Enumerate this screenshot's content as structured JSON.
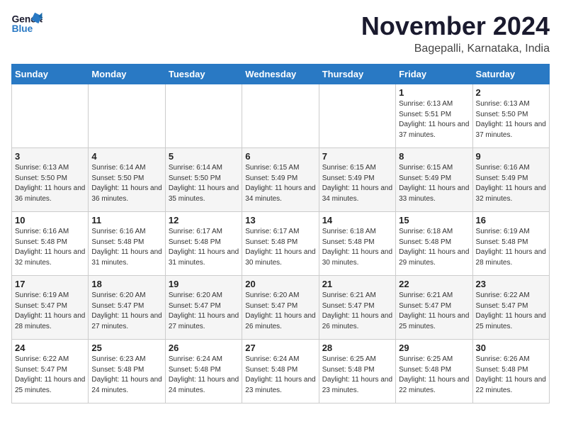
{
  "header": {
    "logo_general": "General",
    "logo_blue": "Blue",
    "month_title": "November 2024",
    "location": "Bagepalli, Karnataka, India"
  },
  "weekdays": [
    "Sunday",
    "Monday",
    "Tuesday",
    "Wednesday",
    "Thursday",
    "Friday",
    "Saturday"
  ],
  "weeks": [
    [
      {
        "day": "",
        "info": ""
      },
      {
        "day": "",
        "info": ""
      },
      {
        "day": "",
        "info": ""
      },
      {
        "day": "",
        "info": ""
      },
      {
        "day": "",
        "info": ""
      },
      {
        "day": "1",
        "info": "Sunrise: 6:13 AM\nSunset: 5:51 PM\nDaylight: 11 hours and 37 minutes."
      },
      {
        "day": "2",
        "info": "Sunrise: 6:13 AM\nSunset: 5:50 PM\nDaylight: 11 hours and 37 minutes."
      }
    ],
    [
      {
        "day": "3",
        "info": "Sunrise: 6:13 AM\nSunset: 5:50 PM\nDaylight: 11 hours and 36 minutes."
      },
      {
        "day": "4",
        "info": "Sunrise: 6:14 AM\nSunset: 5:50 PM\nDaylight: 11 hours and 36 minutes."
      },
      {
        "day": "5",
        "info": "Sunrise: 6:14 AM\nSunset: 5:50 PM\nDaylight: 11 hours and 35 minutes."
      },
      {
        "day": "6",
        "info": "Sunrise: 6:15 AM\nSunset: 5:49 PM\nDaylight: 11 hours and 34 minutes."
      },
      {
        "day": "7",
        "info": "Sunrise: 6:15 AM\nSunset: 5:49 PM\nDaylight: 11 hours and 34 minutes."
      },
      {
        "day": "8",
        "info": "Sunrise: 6:15 AM\nSunset: 5:49 PM\nDaylight: 11 hours and 33 minutes."
      },
      {
        "day": "9",
        "info": "Sunrise: 6:16 AM\nSunset: 5:49 PM\nDaylight: 11 hours and 32 minutes."
      }
    ],
    [
      {
        "day": "10",
        "info": "Sunrise: 6:16 AM\nSunset: 5:48 PM\nDaylight: 11 hours and 32 minutes."
      },
      {
        "day": "11",
        "info": "Sunrise: 6:16 AM\nSunset: 5:48 PM\nDaylight: 11 hours and 31 minutes."
      },
      {
        "day": "12",
        "info": "Sunrise: 6:17 AM\nSunset: 5:48 PM\nDaylight: 11 hours and 31 minutes."
      },
      {
        "day": "13",
        "info": "Sunrise: 6:17 AM\nSunset: 5:48 PM\nDaylight: 11 hours and 30 minutes."
      },
      {
        "day": "14",
        "info": "Sunrise: 6:18 AM\nSunset: 5:48 PM\nDaylight: 11 hours and 30 minutes."
      },
      {
        "day": "15",
        "info": "Sunrise: 6:18 AM\nSunset: 5:48 PM\nDaylight: 11 hours and 29 minutes."
      },
      {
        "day": "16",
        "info": "Sunrise: 6:19 AM\nSunset: 5:48 PM\nDaylight: 11 hours and 28 minutes."
      }
    ],
    [
      {
        "day": "17",
        "info": "Sunrise: 6:19 AM\nSunset: 5:47 PM\nDaylight: 11 hours and 28 minutes."
      },
      {
        "day": "18",
        "info": "Sunrise: 6:20 AM\nSunset: 5:47 PM\nDaylight: 11 hours and 27 minutes."
      },
      {
        "day": "19",
        "info": "Sunrise: 6:20 AM\nSunset: 5:47 PM\nDaylight: 11 hours and 27 minutes."
      },
      {
        "day": "20",
        "info": "Sunrise: 6:20 AM\nSunset: 5:47 PM\nDaylight: 11 hours and 26 minutes."
      },
      {
        "day": "21",
        "info": "Sunrise: 6:21 AM\nSunset: 5:47 PM\nDaylight: 11 hours and 26 minutes."
      },
      {
        "day": "22",
        "info": "Sunrise: 6:21 AM\nSunset: 5:47 PM\nDaylight: 11 hours and 25 minutes."
      },
      {
        "day": "23",
        "info": "Sunrise: 6:22 AM\nSunset: 5:47 PM\nDaylight: 11 hours and 25 minutes."
      }
    ],
    [
      {
        "day": "24",
        "info": "Sunrise: 6:22 AM\nSunset: 5:47 PM\nDaylight: 11 hours and 25 minutes."
      },
      {
        "day": "25",
        "info": "Sunrise: 6:23 AM\nSunset: 5:48 PM\nDaylight: 11 hours and 24 minutes."
      },
      {
        "day": "26",
        "info": "Sunrise: 6:24 AM\nSunset: 5:48 PM\nDaylight: 11 hours and 24 minutes."
      },
      {
        "day": "27",
        "info": "Sunrise: 6:24 AM\nSunset: 5:48 PM\nDaylight: 11 hours and 23 minutes."
      },
      {
        "day": "28",
        "info": "Sunrise: 6:25 AM\nSunset: 5:48 PM\nDaylight: 11 hours and 23 minutes."
      },
      {
        "day": "29",
        "info": "Sunrise: 6:25 AM\nSunset: 5:48 PM\nDaylight: 11 hours and 22 minutes."
      },
      {
        "day": "30",
        "info": "Sunrise: 6:26 AM\nSunset: 5:48 PM\nDaylight: 11 hours and 22 minutes."
      }
    ]
  ]
}
